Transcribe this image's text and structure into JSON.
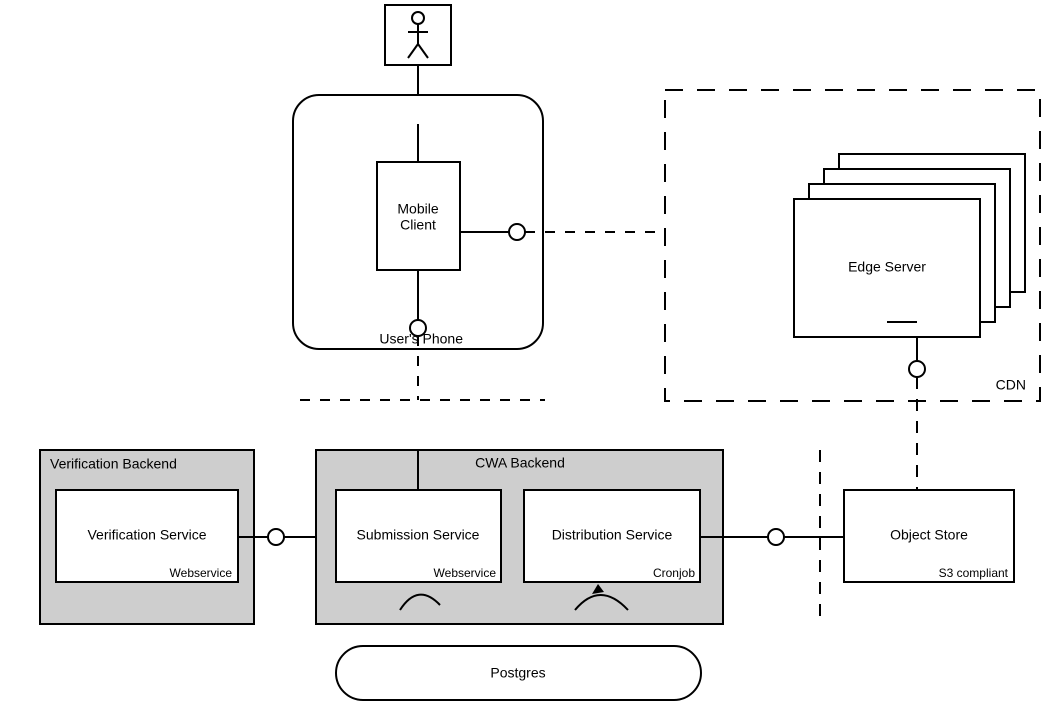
{
  "actor": {
    "label": "user"
  },
  "device": {
    "label": "User's Phone",
    "component": "Mobile Client"
  },
  "cdn": {
    "label": "CDN",
    "node": "Edge Server"
  },
  "verification_backend": {
    "label": "Verification Backend",
    "service": {
      "name": "Verification Service",
      "stereotype": "Webservice"
    }
  },
  "cwa_backend": {
    "label": "CWA Backend",
    "submission": {
      "name": "Submission Service",
      "stereotype": "Webservice"
    },
    "distribution": {
      "name": "Distribution Service",
      "stereotype": "Cronjob"
    }
  },
  "object_store": {
    "name": "Object Store",
    "stereotype": "S3 compliant"
  },
  "database": {
    "name": "Postgres"
  }
}
